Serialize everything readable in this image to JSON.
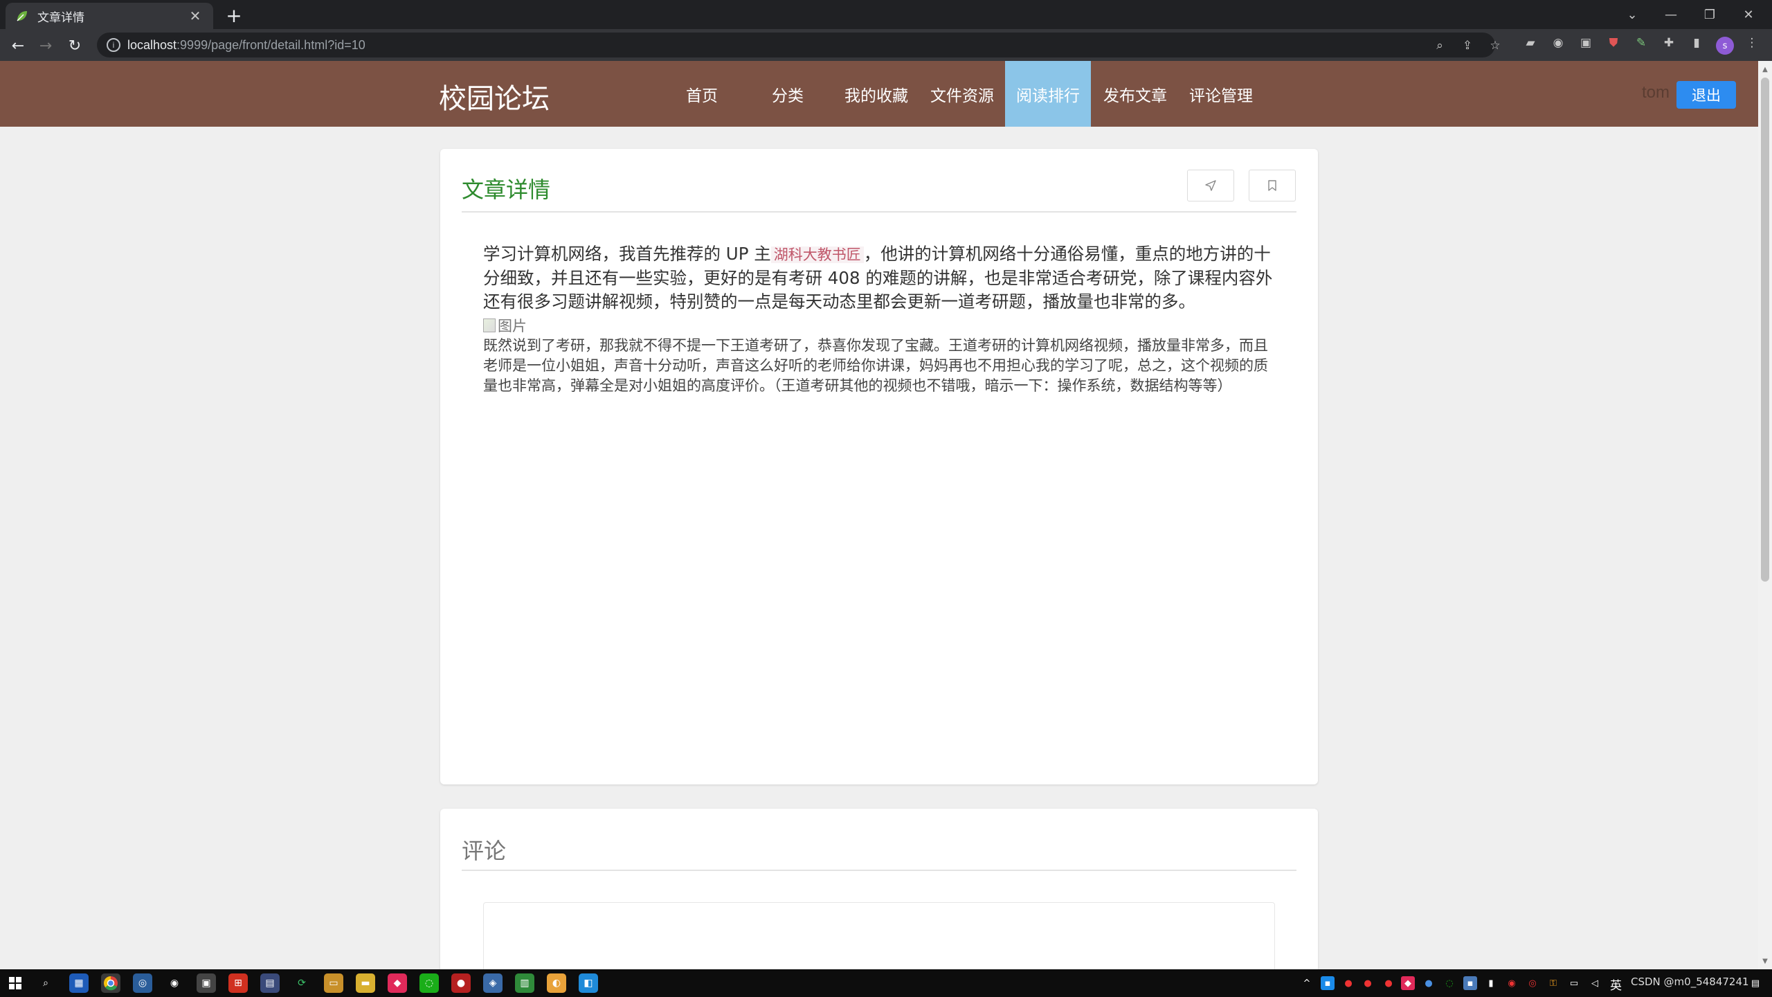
{
  "browser": {
    "tab_title": "文章详情",
    "url_host": "localhost",
    "url_path": ":9999/page/front/detail.html?id=10"
  },
  "site": {
    "logo": "校园论坛",
    "nav": [
      "首页",
      "分类",
      "我的收藏",
      "文件资源",
      "阅读排行",
      "发布文章",
      "评论管理"
    ],
    "active_nav": "阅读排行",
    "username": "tom",
    "logout_label": "退出"
  },
  "article": {
    "section_title": "文章详情",
    "lead_before": "学习计算机网络，我首先推荐的 UP 主",
    "lead_tag": "湖科大教书匠",
    "lead_after": "，他讲的计算机网络十分通俗易懂，重点的地方讲的十分细致，并且还有一些实验，更好的是有考研 408 的难题的讲解，也是非常适合考研党，除了课程内容外还有很多习题讲解视频，特别赞的一点是每天动态里都会更新一道考研题，播放量也非常的多。",
    "image_alt": "图片",
    "paragraph2": "既然说到了考研，那我就不得不提一下王道考研了，恭喜你发现了宝藏。王道考研的计算机网络视频，播放量非常多，而且老师是一位小姐姐，声音十分动听，声音这么好听的老师给你讲课，妈妈再也不用担心我的学习了呢，总之，这个视频的质量也非常高，弹幕全是对小姐姐的高度评价。（王道考研其他的视频也不错哦，暗示一下：操作系统，数据结构等等）"
  },
  "comments": {
    "section_title": "评论"
  },
  "taskbar": {
    "tray_text": "CSDN @m0_54847241",
    "lang": "英"
  },
  "colors": {
    "header_bg": "#7c5244",
    "active_nav_bg": "#8bc5e8",
    "logout_bg": "#2d8cf0",
    "title_green": "#2e8b2e",
    "tag_red": "#c0576a"
  }
}
